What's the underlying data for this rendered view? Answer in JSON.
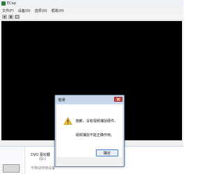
{
  "app": {
    "title": "ECap"
  },
  "menubar": {
    "items": [
      "文件(F)",
      "设备(D)",
      "选项(O)",
      "帮助(H)"
    ]
  },
  "toolbar": {
    "buttons": [
      "capture-icon",
      "stop-icon",
      "photo-icon"
    ]
  },
  "explorer": {
    "drive_label": "DVD 驱动器",
    "drive_letter": "(G:)",
    "faded_label": "可移动存储设备"
  },
  "dialog": {
    "title": "错误",
    "message_line1": "抱歉，没有视频捕捉硬件。",
    "message_line2": "视频捕捉不能正确作用。",
    "ok_label": "确定",
    "colors": {
      "close": "#c9493f",
      "ok_border": "#3f7fcf"
    }
  }
}
